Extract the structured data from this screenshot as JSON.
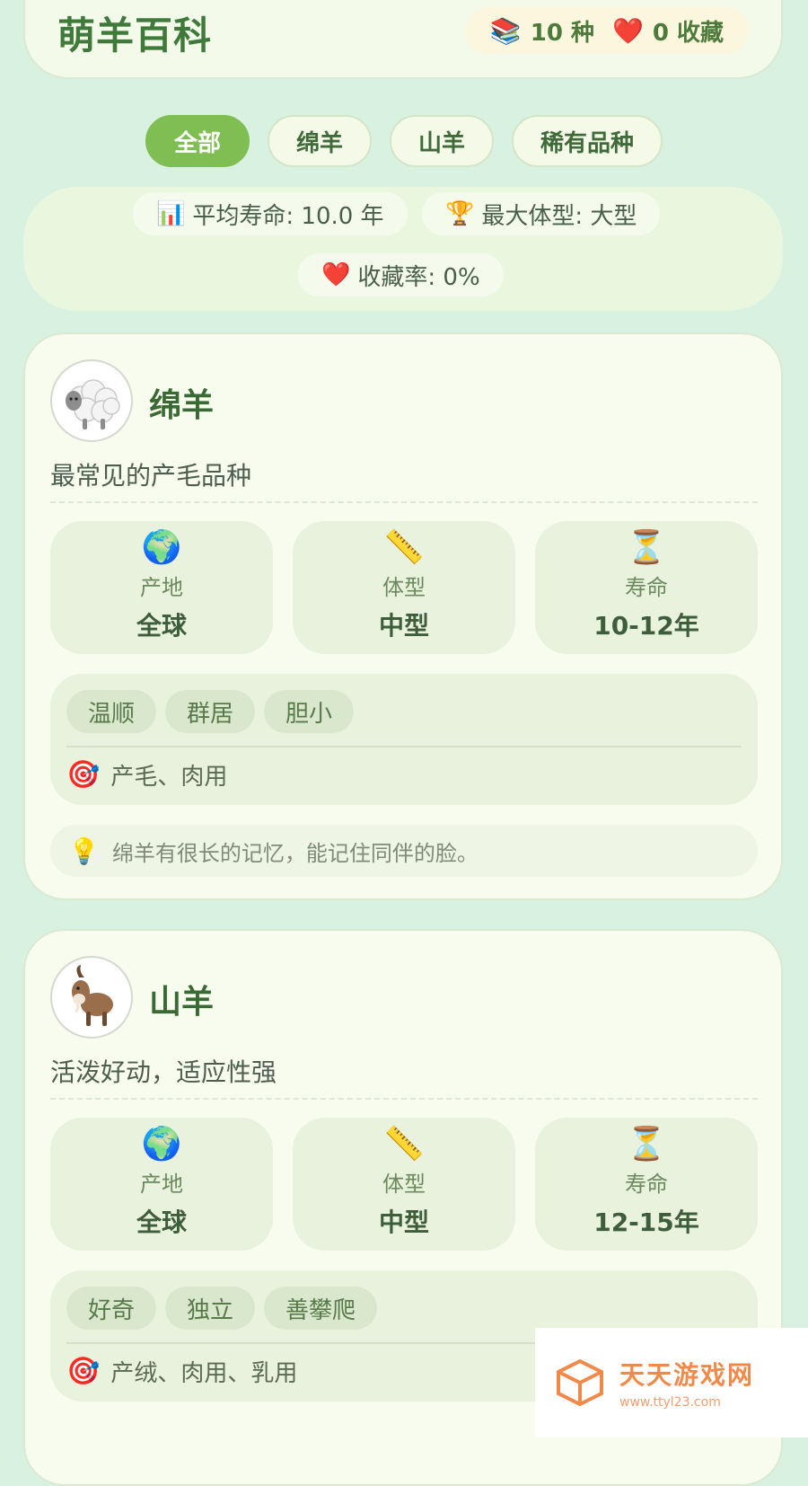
{
  "header": {
    "title": "萌羊百科",
    "species_icon": "books-icon",
    "species_count": "10 种",
    "fav_icon": "heart-icon",
    "fav_count": "0 收藏"
  },
  "filters": [
    "全部",
    "绵羊",
    "山羊",
    "稀有品种"
  ],
  "summary": {
    "avg_life": "平均寿命: 10.0 年",
    "max_size": "最大体型: 大型",
    "fav_rate": "收藏率: 0%"
  },
  "cards": [
    {
      "name": "绵羊",
      "avatar_icon": "sheep-icon",
      "desc": "最常见的产毛品种",
      "stats": [
        {
          "icon": "globe-icon",
          "label": "产地",
          "value": "全球"
        },
        {
          "icon": "ruler-icon",
          "label": "体型",
          "value": "中型"
        },
        {
          "icon": "hourglass-icon",
          "label": "寿命",
          "value": "10-12年"
        }
      ],
      "tags": [
        "温顺",
        "群居",
        "胆小"
      ],
      "use": "产毛、肉用",
      "tip": "绵羊有很长的记忆，能记住同伴的脸。"
    },
    {
      "name": "山羊",
      "avatar_icon": "goat-icon",
      "desc": "活泼好动，适应性强",
      "stats": [
        {
          "icon": "globe-icon",
          "label": "产地",
          "value": "全球"
        },
        {
          "icon": "ruler-icon",
          "label": "体型",
          "value": "中型"
        },
        {
          "icon": "hourglass-icon",
          "label": "寿命",
          "value": "12-15年"
        }
      ],
      "tags": [
        "好奇",
        "独立",
        "善攀爬"
      ],
      "use": "产绒、肉用、乳用"
    }
  ],
  "watermark": {
    "brand": "天天游戏网",
    "url": "www.ttyl23.com"
  }
}
